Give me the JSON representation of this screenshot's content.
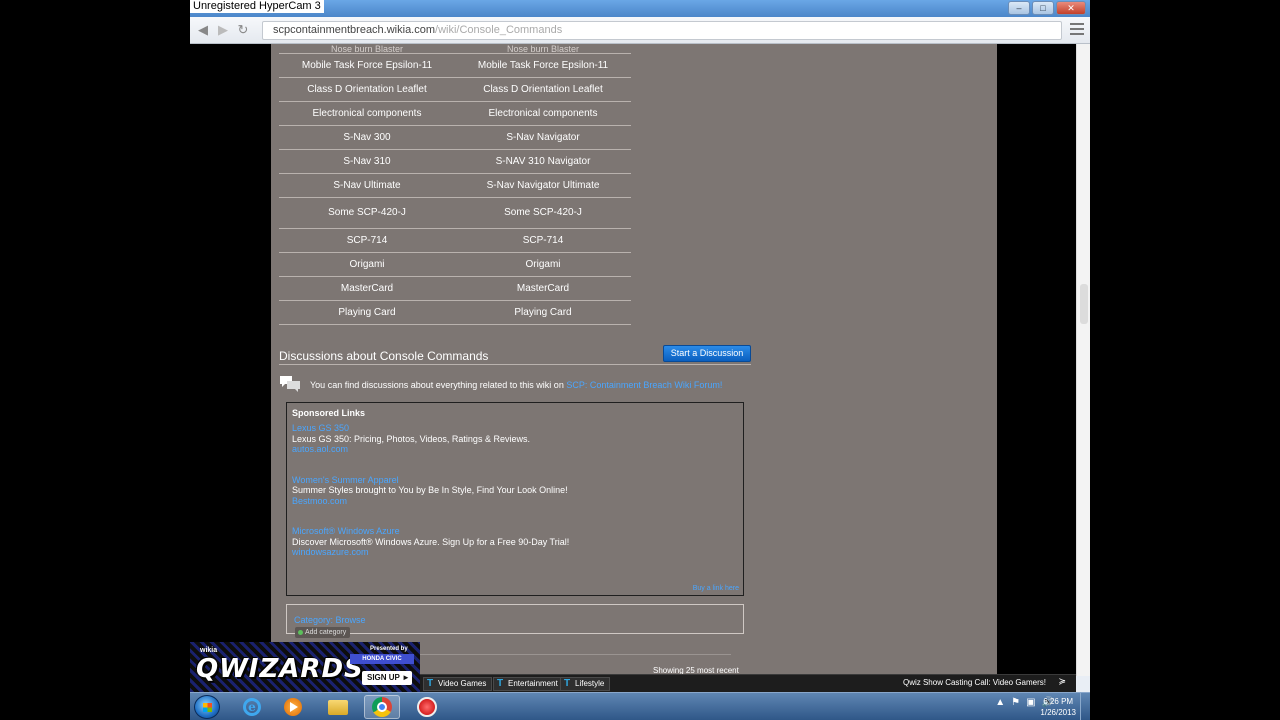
{
  "recorder": {
    "watermark": "Unregistered HyperCam 3"
  },
  "browser": {
    "url_host": "scpcontainmentbreach.wikia.com",
    "url_path": "/wiki/Console_Commands",
    "window_controls": {
      "minimize": "–",
      "maximize": "□",
      "close": "✕"
    }
  },
  "item_table": {
    "first_row": [
      "Nose burn Blaster",
      "Nose burn Blaster"
    ],
    "rows": [
      [
        "Mobile Task Force Epsilon-11",
        "Mobile Task Force Epsilon-11"
      ],
      [
        "Class D Orientation Leaflet",
        "Class D Orientation Leaflet"
      ],
      [
        "Electronical components",
        "Electronical components"
      ],
      [
        "S-Nav 300",
        "S-Nav Navigator"
      ],
      [
        "S-Nav 310",
        "S-NAV 310 Navigator"
      ],
      [
        "S-Nav Ultimate",
        "S-Nav Navigator Ultimate"
      ],
      [
        "Some SCP-420-J",
        "Some SCP-420-J"
      ],
      [
        "SCP-714",
        "SCP-714"
      ],
      [
        "Origami",
        "Origami"
      ],
      [
        "MasterCard",
        "MasterCard"
      ],
      [
        "Playing Card",
        "Playing Card"
      ]
    ]
  },
  "discussions": {
    "title": "Discussions about Console Commands",
    "start_button": "Start a Discussion",
    "text": "You can find discussions about everything related to this wiki on",
    "forum_link": "SCP: Containment Breach Wiki Forum!"
  },
  "sponsored": {
    "heading": "Sponsored Links",
    "ads": [
      {
        "title": "Lexus GS 350",
        "desc": "Lexus GS 350: Pricing, Photos, Videos, Ratings & Reviews.",
        "url": "autos.aol.com"
      },
      {
        "title": "Women's Summer Apparel",
        "desc": "Summer Styles brought to You by Be In Style, Find Your Look Online!",
        "url": "Bestmoo.com"
      },
      {
        "title": "Microsoft® Windows Azure",
        "desc": "Discover Microsoft® Windows Azure. Sign Up for a Free 90-Day Trial!",
        "url": "windowsazure.com"
      }
    ],
    "buy_link": "Buy a link here"
  },
  "categories": {
    "label": "Category: Browse",
    "add_button": "Add category"
  },
  "showing": "Showing 25 most recent",
  "wikia_bar": {
    "tabs": [
      "Video Games",
      "Entertainment",
      "Lifestyle"
    ],
    "news": "Qwiz Show Casting Call: Video Gamers!",
    "qwiz_small": "wikia",
    "qwiz_logo": "QWIZARDS",
    "qwiz_presented": "Presented by",
    "qwiz_sponsor": "HONDA CIVIC",
    "qwiz_signup": "SIGN UP ►"
  },
  "taskbar": {
    "clock_time": "6:26 PM",
    "clock_date": "1/26/2013",
    "tray_icons": [
      "▲",
      "⚑",
      "▣",
      "🔊"
    ]
  },
  "colors": {
    "page_bg": "#7d7673",
    "link": "#4aa6ff",
    "button": "#0a5fbf"
  }
}
